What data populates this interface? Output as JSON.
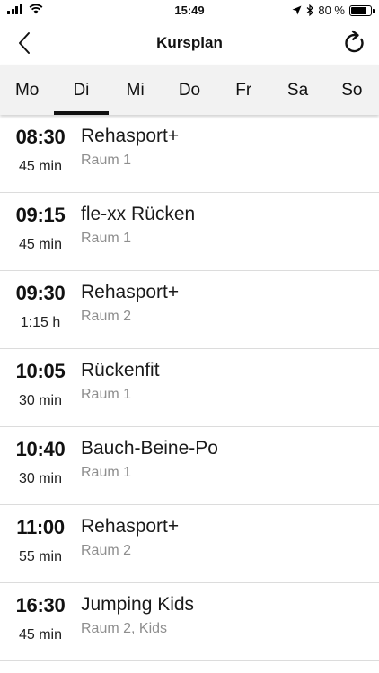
{
  "status_bar": {
    "time": "15:49",
    "battery_text": "80 %",
    "battery_level": 0.8,
    "icons": [
      "signal-icon",
      "wifi-icon",
      "location-icon",
      "bluetooth-icon",
      "battery-icon"
    ]
  },
  "nav": {
    "title": "Kursplan",
    "back_icon": "chevron-left-icon",
    "refresh_icon": "refresh-icon"
  },
  "tabs": [
    {
      "label": "Mo",
      "active": false
    },
    {
      "label": "Di",
      "active": true
    },
    {
      "label": "Mi",
      "active": false
    },
    {
      "label": "Do",
      "active": false
    },
    {
      "label": "Fr",
      "active": false
    },
    {
      "label": "Sa",
      "active": false
    },
    {
      "label": "So",
      "active": false
    }
  ],
  "courses": [
    {
      "time": "08:30",
      "duration": "45 min",
      "title": "Rehasport+",
      "room": "Raum 1"
    },
    {
      "time": "09:15",
      "duration": "45 min",
      "title": "fle-xx Rücken",
      "room": "Raum 1"
    },
    {
      "time": "09:30",
      "duration": "1:15 h",
      "title": "Rehasport+",
      "room": "Raum 2"
    },
    {
      "time": "10:05",
      "duration": "30 min",
      "title": "Rückenfit",
      "room": "Raum 1"
    },
    {
      "time": "10:40",
      "duration": "30 min",
      "title": "Bauch-Beine-Po",
      "room": "Raum 1"
    },
    {
      "time": "11:00",
      "duration": "55 min",
      "title": "Rehasport+",
      "room": "Raum 2"
    },
    {
      "time": "16:30",
      "duration": "45 min",
      "title": "Jumping Kids",
      "room": "Raum 2, Kids"
    }
  ]
}
